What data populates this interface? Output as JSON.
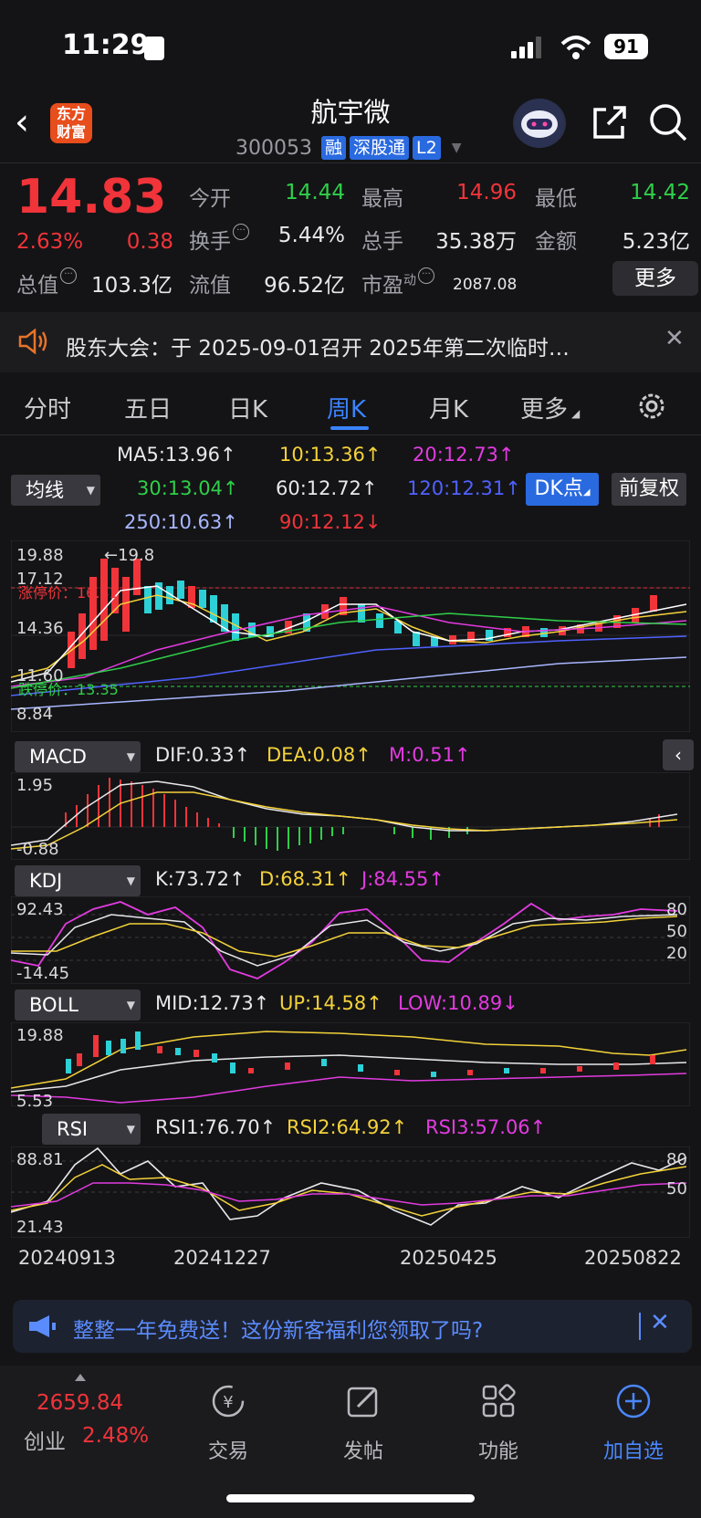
{
  "status": {
    "time": "11:29",
    "battery": "91"
  },
  "header": {
    "brand": "东方\n财富",
    "name": "航宇微",
    "code": "300053",
    "tags": [
      "融",
      "深股通",
      "L2"
    ]
  },
  "quote": {
    "price": "14.83",
    "pct": "2.63%",
    "change": "0.38",
    "open_label": "今开",
    "open": "14.44",
    "high_label": "最高",
    "high": "14.96",
    "low_label": "最低",
    "low": "14.42",
    "turnover_label": "换手",
    "turnover": "5.44%",
    "volume_label": "总手",
    "volume": "35.38万",
    "amount_label": "金额",
    "amount": "5.23亿",
    "mktcap_label": "总值",
    "mktcap": "103.3亿",
    "float_label": "流值",
    "float": "96.52亿",
    "pe_label": "市盈",
    "pe_sup": "动",
    "pe": "2087.08",
    "more": "更多"
  },
  "notice": {
    "text": "股东大会：于 2025-09-01召开 2025年第二次临时…"
  },
  "tabs": [
    "分时",
    "五日",
    "日K",
    "周K",
    "月K",
    "更多"
  ],
  "ma": {
    "selector": "均线",
    "ma5": "MA5:13.96↑",
    "ma10": "10:13.36↑",
    "ma20": "20:12.73↑",
    "ma30": "30:13.04↑",
    "ma60": "60:12.72↑",
    "ma120": "120:12.31↑",
    "ma250": "250:10.63↑",
    "ma90": "90:12.12↓",
    "dk": "DK点",
    "fq": "前复权"
  },
  "kchart": {
    "ymax": "19.88",
    "y1": "17.12",
    "y2": "14.36",
    "y3": "11.60",
    "ymin": "8.84",
    "peak_label": "←19.8",
    "limit_up": "涨停价：16.31",
    "limit_down": "跌停价：13.35"
  },
  "macd": {
    "name": "MACD",
    "dif": "DIF:0.33↑",
    "dea": "DEA:0.08↑",
    "m": "M:0.51↑",
    "ymax": "1.95",
    "ymin": "-0.88"
  },
  "kdj": {
    "name": "KDJ",
    "k": "K:73.72↑",
    "d": "D:68.31↑",
    "j": "J:84.55↑",
    "ymax": "92.43",
    "ymin": "-14.45",
    "r80": "80",
    "r50": "50",
    "r20": "20"
  },
  "boll": {
    "name": "BOLL",
    "mid": "MID:12.73↑",
    "up": "UP:14.58↑",
    "low": "LOW:10.89↓",
    "ymax": "19.88",
    "ymin": "5.53"
  },
  "rsi": {
    "name": "RSI",
    "r1": "RSI1:76.70↑",
    "r2": "RSI2:64.92↑",
    "r3": "RSI3:57.06↑",
    "ymax": "88.81",
    "ymin": "21.43",
    "r80": "80",
    "r50": "50"
  },
  "dates": [
    "20240913",
    "20241227",
    "20250425",
    "20250822"
  ],
  "promo": {
    "text": "整整一年免费送！这份新客福利您领取了吗?"
  },
  "nav": {
    "index_value": "2659.84",
    "index_name": "创业",
    "index_pct": "2.48%",
    "trade": "交易",
    "post": "发帖",
    "func": "功能",
    "add": "加自选"
  }
}
